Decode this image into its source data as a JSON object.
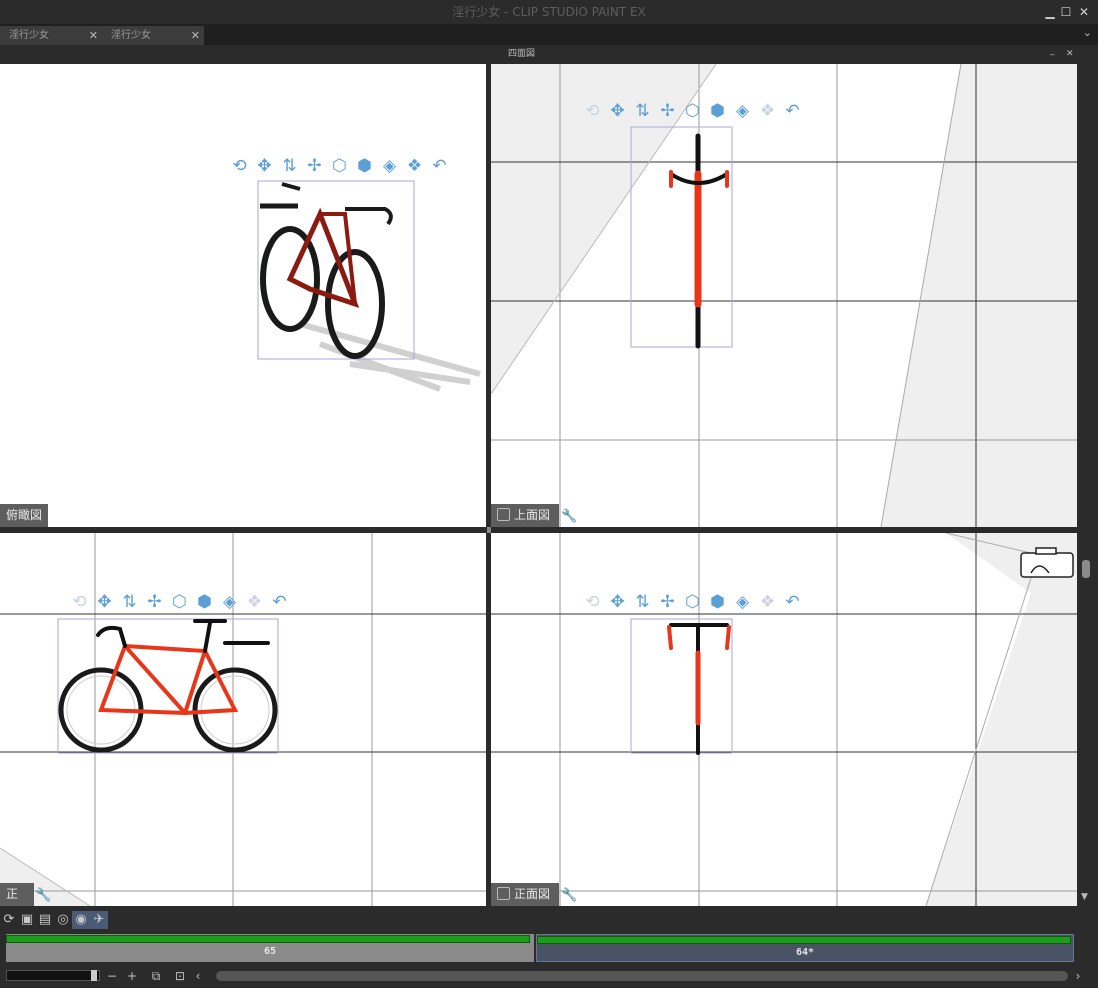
{
  "window": {
    "title": "淫行少女 - CLIP STUDIO PAINT EX",
    "minimize_icon": "minimize-icon",
    "maximize_icon": "maximize-icon",
    "close_icon": "close-icon"
  },
  "tabs": [
    {
      "label": "淫行少女",
      "close": "✕"
    },
    {
      "label": "淫行少女",
      "close": "✕"
    }
  ],
  "panel": {
    "title": "四面図",
    "minimize": "_",
    "close": "✕"
  },
  "viewports": {
    "perspective": {
      "label": "俯瞰図"
    },
    "top": {
      "label": "上面図"
    },
    "side": {
      "label": "正面図"
    },
    "front": {
      "label": "正面図"
    }
  },
  "object_tools": [
    {
      "name": "camera-rotate-icon",
      "glyph": "⟲"
    },
    {
      "name": "camera-pan-icon",
      "glyph": "✥"
    },
    {
      "name": "camera-dolly-icon",
      "glyph": "⇅"
    },
    {
      "name": "object-move-icon",
      "glyph": "✢"
    },
    {
      "name": "object-rotate-plane-icon",
      "glyph": "⬡"
    },
    {
      "name": "object-rotate-x-icon",
      "glyph": "⬢"
    },
    {
      "name": "object-rotate-y-icon",
      "glyph": "◈"
    },
    {
      "name": "object-rotate-z-icon",
      "glyph": "❖"
    },
    {
      "name": "reset-icon",
      "glyph": "↶"
    }
  ],
  "timeline": {
    "tracks": [
      {
        "label": "65"
      },
      {
        "label": "64*"
      }
    ]
  },
  "bottom_controls": {
    "minus": "−",
    "plus": "+"
  },
  "colors": {
    "accent_tool": "#5b9fd7",
    "track_green": "#1c9b1c",
    "selected_track": "#4a5266",
    "bike_frame": "#e8361a"
  }
}
